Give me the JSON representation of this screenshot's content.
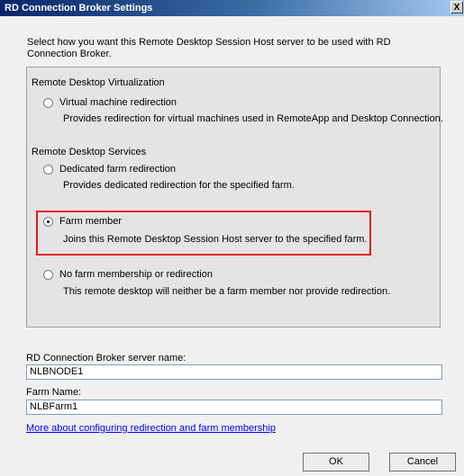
{
  "window": {
    "title": "RD Connection Broker Settings",
    "close_glyph": "X"
  },
  "intro": "Select how you want this Remote Desktop Session Host server to be used with RD Connection Broker.",
  "sections": {
    "virtualization": "Remote Desktop Virtualization",
    "services": "Remote Desktop Services"
  },
  "options": {
    "vm_redirection": {
      "label": "Virtual machine redirection",
      "desc": "Provides redirection for virtual machines used in RemoteApp and Desktop Connection.",
      "checked": false
    },
    "dedicated_farm": {
      "label": "Dedicated farm redirection",
      "desc": "Provides dedicated redirection for the specified farm.",
      "checked": false
    },
    "farm_member": {
      "label": "Farm member",
      "desc": "Joins this Remote Desktop Session Host server to the specified farm.",
      "checked": true
    },
    "no_farm": {
      "label": "No farm membership or redirection",
      "desc": "This remote desktop will neither be a farm member nor provide redirection.",
      "checked": false
    }
  },
  "fields": {
    "broker_label": "RD Connection Broker server name:",
    "broker_value": "NLBNODE1",
    "farm_label": "Farm Name:",
    "farm_value": "NLBFarm1"
  },
  "link": "More about configuring redirection and farm membership",
  "buttons": {
    "ok": "OK",
    "cancel": "Cancel"
  },
  "colors": {
    "highlight_border": "#e8161b",
    "link": "#0000ff",
    "title_bar": "#0a246a"
  }
}
